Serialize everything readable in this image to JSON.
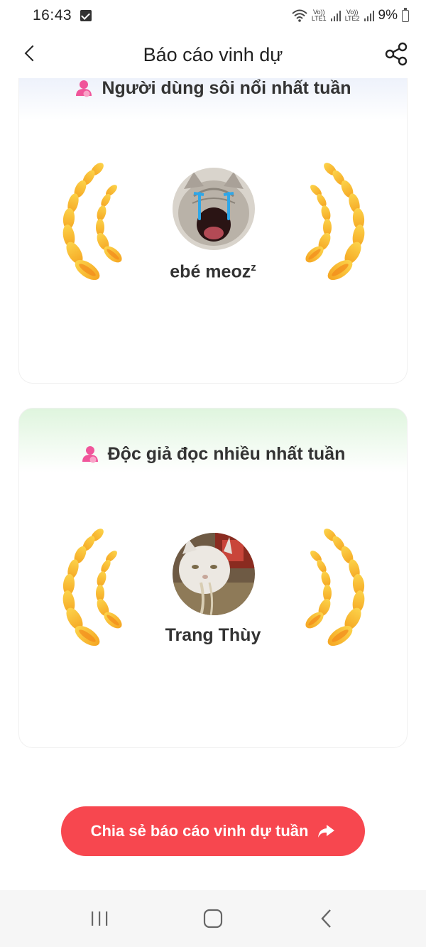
{
  "status_bar": {
    "time": "16:43",
    "lte1": "Vo))\nLTE1",
    "lte2": "Vo))\nLTE2",
    "battery": "9%"
  },
  "header": {
    "title": "Báo cáo vinh dự",
    "back_icon": "chevron-left-icon",
    "share_icon": "share-icon"
  },
  "cards": [
    {
      "heading": "Người dùng sôi nổi nhất tuần",
      "icon": "user-icon",
      "user_name": "ebé meoz",
      "user_name_sup": "z"
    },
    {
      "heading": "Độc giả đọc nhiều nhất tuần",
      "icon": "user-icon",
      "user_name": "Trang Thùy"
    }
  ],
  "share_button": {
    "label": "Chia sẻ báo cáo vinh dự tuần",
    "icon": "forward-arrow-icon"
  },
  "nav_bar": {
    "recents_icon": "recent-apps-icon",
    "home_icon": "home-icon",
    "back_icon": "back-icon"
  },
  "colors": {
    "accent": "#f7474f",
    "laurel_light": "#fcd34a",
    "laurel_dark": "#f38a1a",
    "user_icon": "#f0559a"
  }
}
